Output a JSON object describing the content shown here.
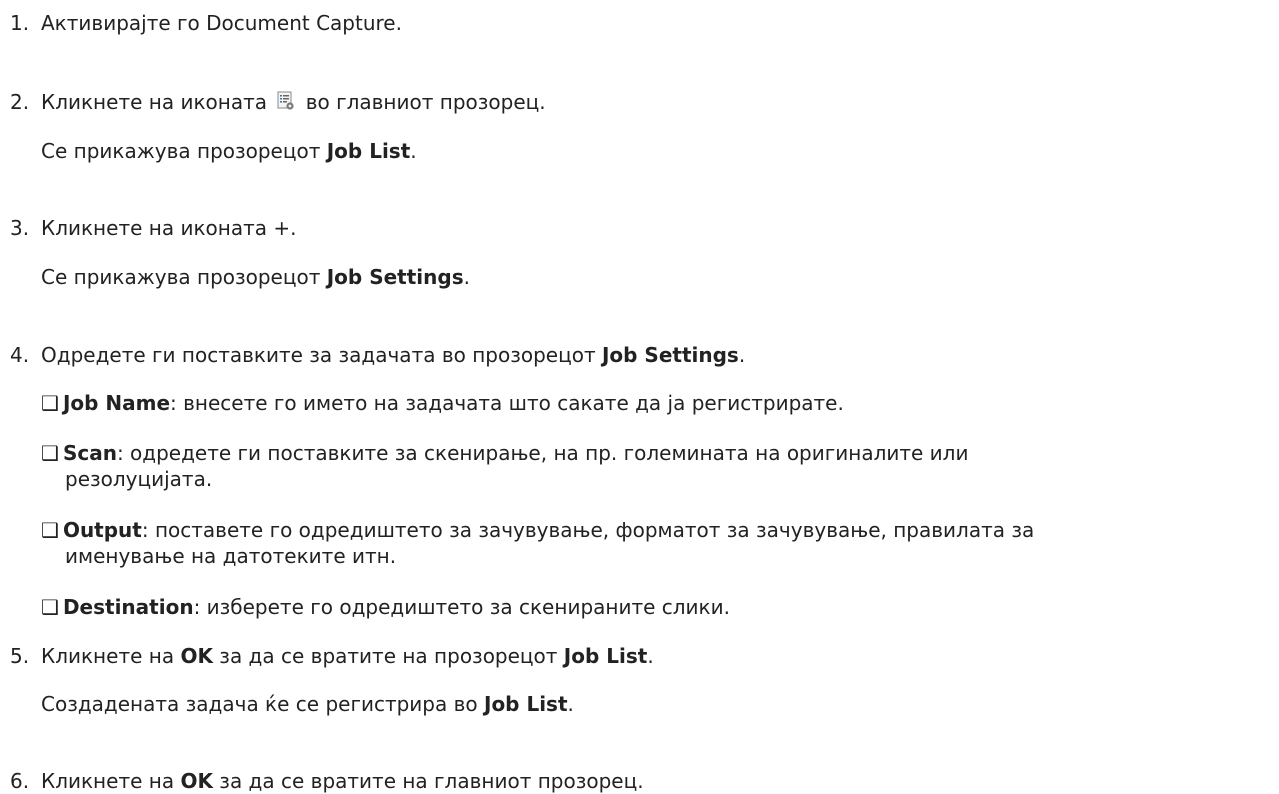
{
  "steps": [
    {
      "number": "1.",
      "text": "Активирајте го Document Capture."
    },
    {
      "number": "2.",
      "text_before": "Кликнете на иконата",
      "text_after": "во главниот прозорец.",
      "icon": "job-settings-icon",
      "note_before": "Се прикажува прозорецот ",
      "note_bold": "Job List",
      "note_after": "."
    },
    {
      "number": "3.",
      "text": "Кликнете на иконата +.",
      "note_before": "Се прикажува прозорецот ",
      "note_bold": "Job Settings",
      "note_after": "."
    },
    {
      "number": "4.",
      "text_before": "Одредете ги поставките за задачата во прозорецот ",
      "text_bold": "Job Settings",
      "text_after": "."
    },
    {
      "number": "5.",
      "text_before": "Кликнете на ",
      "text_bold": "OK",
      "text_middle": " за да се вратите на прозорецот ",
      "text_bold2": "Job List",
      "text_after": ".",
      "note_before": "Создадената задача ќе се регистрира во ",
      "note_bold": "Job List",
      "note_after": "."
    },
    {
      "number": "6.",
      "text_before": "Кликнете на ",
      "text_bold": "OK",
      "text_after": " за да се вратите на главниот прозорец."
    }
  ],
  "bullet_glyph": "❑",
  "bullets": [
    {
      "label": "Job Name",
      "text": ": внесете го името на задачата што сакате да ја регистрирате."
    },
    {
      "label": "Scan",
      "text": ": одредете ги поставките за скенирање, на пр. големината на оригиналите или",
      "cont": "резолуцијата."
    },
    {
      "label": "Output",
      "text": ": поставете го одредиштето за зачувување, форматот за зачувување, правилата за",
      "cont": "именување на датотеките итн."
    },
    {
      "label": "Destination",
      "text": ": изберете го одредиштето за скенираните слики."
    }
  ]
}
